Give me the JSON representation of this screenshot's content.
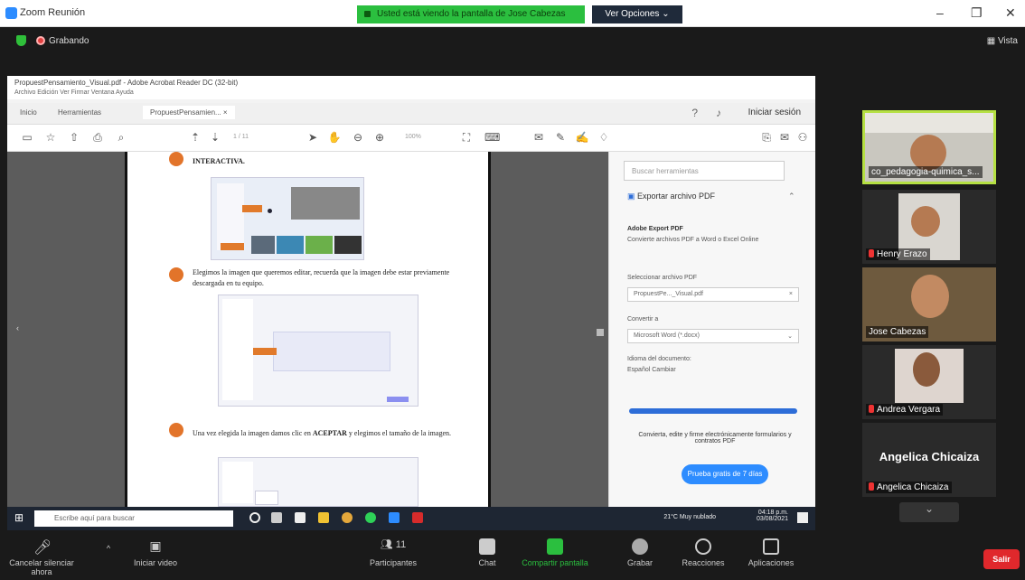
{
  "window": {
    "title": "Zoom Reunión"
  },
  "banner": {
    "sharing_text": "Usted está viendo la pantalla de Jose Cabezas",
    "view_options": "Ver Opciones ⌄"
  },
  "meeting": {
    "recording_label": "Grabando",
    "view_label": "Vista"
  },
  "acrobat": {
    "title": "PropuestPensamiento_Visual.pdf - Adobe Acrobat Reader DC (32-bit)",
    "menu": "Archivo  Edición  Ver  Firmar  Ventana  Ayuda",
    "tabs": [
      "Inicio",
      "Herramientas",
      "PropuestPensamien... ×"
    ],
    "signin": "Iniciar sesión",
    "page_indicator": "1 / 11",
    "zoom": "100%",
    "doc": {
      "line1": "INTERACTIVA.",
      "para2": "Elegimos la imagen que queremos editar, recuerda que la imagen debe estar previamente descargada en tu equipo.",
      "para3_a": "Una vez elegida la imagen damos clic en ",
      "para3_b": "ACEPTAR",
      "para3_c": " y elegimos el tamaño de la imagen."
    },
    "panel": {
      "search_placeholder": "Buscar herramientas",
      "export_pdf": "Exportar archivo PDF",
      "adobe_export": "Adobe Export PDF",
      "convert_desc": "Convierte archivos PDF a Word o Excel Online",
      "select_file": "Seleccionar archivo PDF",
      "file_name": "PropuestPe..._Visual.pdf",
      "convert_to": "Convertir a",
      "format": "Microsoft Word (*.docx)",
      "doc_lang": "Idioma del documento:",
      "lang_value": "Español  Cambiar",
      "footer_text": "Convierta, edite y firme electrónicamente formularios y contratos PDF",
      "trial_button": "Prueba gratis de 7 días"
    }
  },
  "taskbar": {
    "search_placeholder": "Escribe aquí para buscar",
    "weather": "21°C  Muy nublado",
    "time": "04:18 p.m.",
    "date": "03/08/2021"
  },
  "participants_tiles": [
    {
      "name": "co_pedagogia-quimica_s...",
      "active": true
    },
    {
      "name": "Henry Erazo",
      "muted": true
    },
    {
      "name": "Jose Cabezas"
    },
    {
      "name": "Andrea Vergara",
      "muted": true
    },
    {
      "name": "Angelica Chicaiza",
      "big_label": "Angelica Chicaiza",
      "muted": true
    }
  ],
  "controls": {
    "mute": "Cancelar silenciar ahora",
    "video": "Iniciar video",
    "participants": "Participantes",
    "participants_count": "11",
    "chat": "Chat",
    "share": "Compartir pantalla",
    "record": "Grabar",
    "reactions": "Reacciones",
    "apps": "Aplicaciones",
    "leave": "Salir"
  }
}
